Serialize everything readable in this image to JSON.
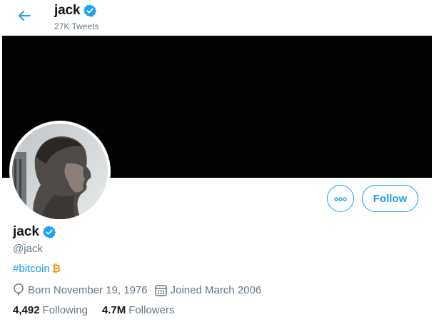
{
  "header": {
    "name": "jack",
    "tweet_count": "27K Tweets",
    "back_icon": "arrow-left-icon"
  },
  "profile": {
    "name": "jack",
    "handle": "@jack",
    "verified": true,
    "bio_hashtag": "#bitcoin",
    "bio_symbol": "₿",
    "born": "Born November 19, 1976",
    "joined": "Joined March 2006",
    "following_count": "4,492",
    "following_label": "Following",
    "followers_count": "4.7M",
    "followers_label": "Followers"
  },
  "actions": {
    "more_label": "More",
    "follow_label": "Follow"
  },
  "colors": {
    "accent": "#1da1f2",
    "secondary_text": "#657786",
    "banner": "#030303",
    "bitcoin": "#f7931a"
  }
}
